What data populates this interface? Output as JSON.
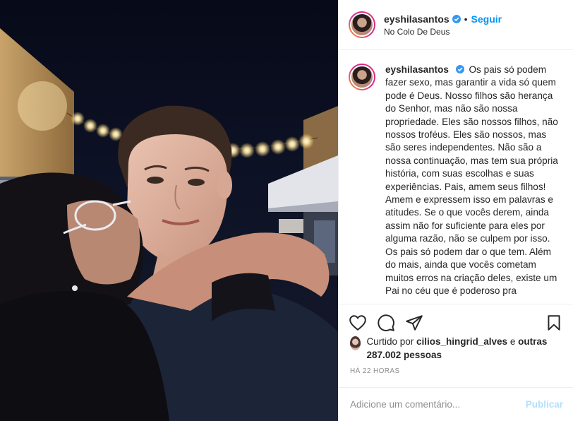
{
  "post": {
    "username": "eyshilasantos",
    "location": "No Colo De Deus",
    "follow_label": "Seguir",
    "separator": "•"
  },
  "caption": {
    "username": "eyshilasantos",
    "text": "Os pais só podem fazer sexo, mas garantir a vida só quem pode é Deus. Nosso filhos são herança do Senhor, mas não são nossa propriedade. Eles são nossos filhos, não nossos troféus. Eles são nossos, mas são seres independentes. Não são a nossa continuação, mas tem sua própria história, com suas escolhas e suas experiências. Pais, amem seus filhos! Amem e expressem isso em palavras e atitudes. Se o que vocês derem, ainda assim não for suficiente para eles por alguma razão, não se culpem por isso. Os pais só podem dar o que tem. Além do mais, ainda que vocês cometam muitos erros na criação deles, existe um Pai no céu que é poderoso pra"
  },
  "likes": {
    "prefix": "Curtido por",
    "user": "cilios_hingrid_alves",
    "mid": "e",
    "others": "outras 287.002 pessoas"
  },
  "timestamp": "HÁ 22 HORAS",
  "comment": {
    "placeholder": "Adicione um comentário...",
    "publish_label": "Publicar"
  },
  "icons": {
    "like": "heart-icon",
    "comment": "comment-icon",
    "share": "share-icon",
    "save": "bookmark-icon",
    "verified": "verified-badge-icon"
  },
  "colors": {
    "accent": "#0095f6",
    "publish_disabled": "#b2dffc",
    "muted": "#8e8e8e",
    "verified": "#3897f0"
  }
}
